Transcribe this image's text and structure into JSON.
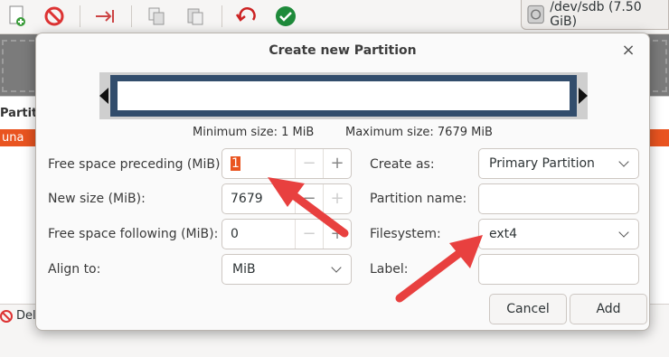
{
  "toolbar": {
    "device_label": "/dev/sdb (7.50 GiB)"
  },
  "background": {
    "partition_header": "Partiti",
    "unallocated_row": "una",
    "status_delete": "Del"
  },
  "dialog": {
    "title": "Create new Partition",
    "close": "×",
    "min_size": "Minimum size: 1 MiB",
    "max_size": "Maximum size: 7679 MiB",
    "fields": {
      "free_preceding_label": "Free space preceding (MiB):",
      "free_preceding_value": "1",
      "new_size_label": "New size (MiB):",
      "new_size_value": "7679",
      "free_following_label": "Free space following (MiB):",
      "free_following_value": "0",
      "align_label": "Align to:",
      "align_value": "MiB",
      "create_as_label": "Create as:",
      "create_as_value": "Primary Partition",
      "partition_name_label": "Partition name:",
      "partition_name_value": "",
      "filesystem_label": "Filesystem:",
      "filesystem_value": "ext4",
      "label_label": "Label:",
      "label_value": ""
    },
    "spin_minus": "−",
    "spin_plus": "+",
    "cancel": "Cancel",
    "add": "Add"
  },
  "colors": {
    "accent": "#e95420",
    "annotation_arrow": "#e8403f",
    "partition_frame": "#324d6c"
  }
}
